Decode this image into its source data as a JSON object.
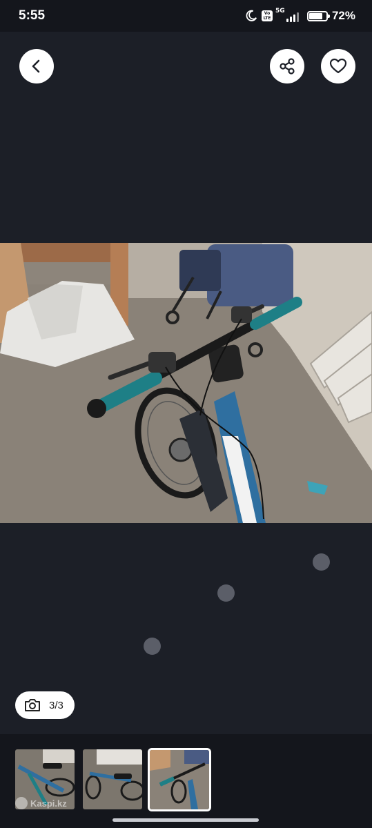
{
  "status_bar": {
    "time": "5:55",
    "network": "5G",
    "volte": "Vo LTE",
    "battery_percent_label": "72%",
    "battery_level": 0.72
  },
  "header": {
    "back_icon": "chevron-left-icon",
    "share_icon": "share-icon",
    "favorite_icon": "heart-icon"
  },
  "gallery": {
    "counter": "3/3",
    "counter_icon": "camera-icon",
    "thumbnails": [
      {
        "label": "photo-1",
        "selected": false
      },
      {
        "label": "photo-2",
        "selected": false
      },
      {
        "label": "photo-3",
        "selected": true
      }
    ],
    "watermark": "Kaspi.kz"
  },
  "colors": {
    "background": "#1c1f27",
    "bar_background": "#14161c",
    "bike_teal": "#1e7f86"
  }
}
